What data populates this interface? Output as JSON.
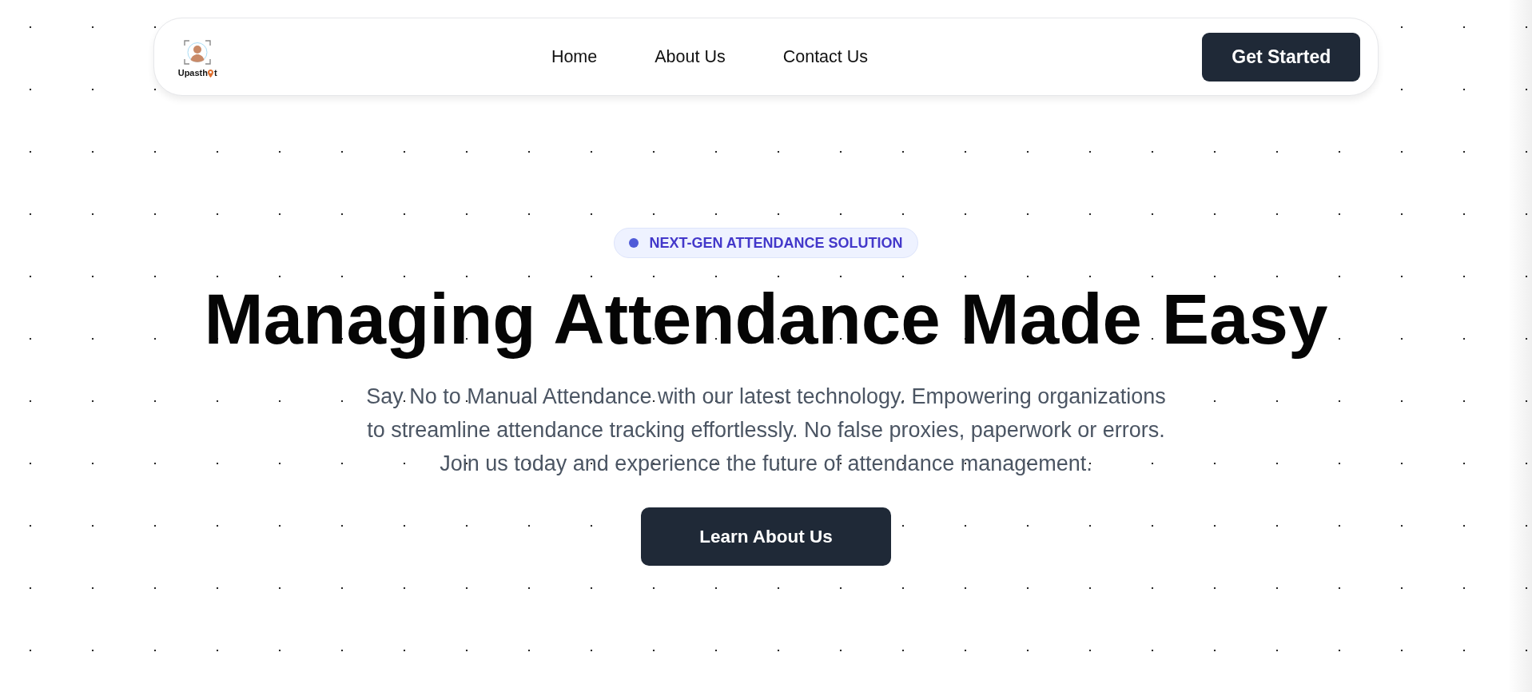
{
  "navbar": {
    "logo": {
      "wordmark": [
        "Upasth",
        "t"
      ]
    },
    "links": [
      "Home",
      "About Us",
      "Contact Us"
    ],
    "button": "Get Started"
  },
  "hero": {
    "badge": "NEXT-GEN ATTENDANCE SOLUTION",
    "title": "Managing Attendance Made Easy",
    "description": "Say No to Manual Attendance with our latest technology. Empowering organizations to streamline attendance tracking effortlessly. No false proxies, paperwork or errors. Join us today and experience the future of attendance management.",
    "button": "Learn About Us"
  }
}
